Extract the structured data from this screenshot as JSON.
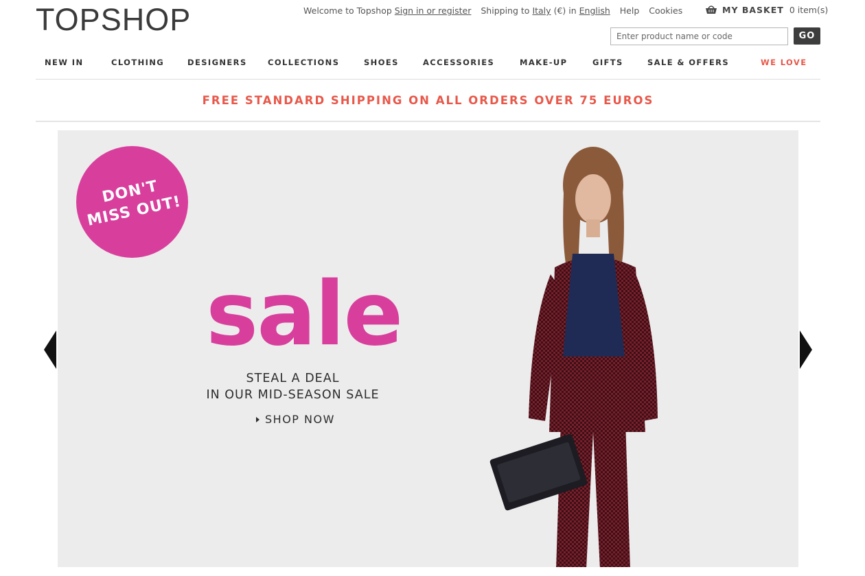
{
  "brand": {
    "logo": "TOPSHOP"
  },
  "utility": {
    "welcome": "Welcome to Topshop",
    "sign_in": "Sign in or register",
    "shipping_prefix": "Shipping to",
    "country": "Italy",
    "currency_in": "(€) in",
    "language": "English",
    "help": "Help",
    "cookies": "Cookies"
  },
  "basket": {
    "label": "MY BASKET",
    "count": "0 item(s)",
    "icon": "basket-icon"
  },
  "search": {
    "placeholder": "Enter product name or code",
    "button": "GO"
  },
  "nav": {
    "items": [
      {
        "label": "NEW IN"
      },
      {
        "label": "CLOTHING"
      },
      {
        "label": "DESIGNERS"
      },
      {
        "label": "COLLECTIONS"
      },
      {
        "label": "SHOES"
      },
      {
        "label": "ACCESSORIES"
      },
      {
        "label": "MAKE-UP"
      },
      {
        "label": "GIFTS"
      },
      {
        "label": "SALE & OFFERS"
      },
      {
        "label": "WE LOVE"
      }
    ]
  },
  "promo": {
    "text": "FREE STANDARD SHIPPING ON ALL ORDERS OVER 75 EUROS"
  },
  "hero": {
    "badge_line1": "DON'T",
    "badge_line2": "MISS OUT!",
    "sale_word": "sale",
    "subline1": "STEAL A DEAL",
    "subline2": "IN OUR MID-SEASON SALE",
    "cta": "SHOP NOW"
  },
  "colors": {
    "accent_red": "#e8584a",
    "sale_pink": "#d83f9d",
    "hero_bg": "#ececed"
  }
}
